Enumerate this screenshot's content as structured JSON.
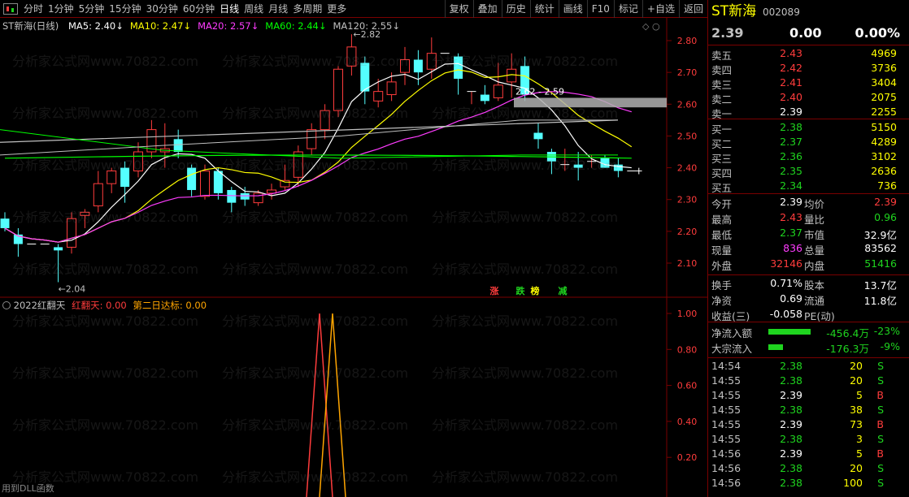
{
  "toolbar": {
    "periods": [
      "分时",
      "1分钟",
      "5分钟",
      "15分钟",
      "30分钟",
      "60分钟",
      "日线",
      "周线",
      "月线",
      "多周期",
      "更多"
    ],
    "active_period": "日线",
    "right_buttons": [
      "复权",
      "叠加",
      "历史",
      "统计",
      "画线",
      "F10",
      "标记",
      "+自选",
      "返回"
    ]
  },
  "main_chart": {
    "title": "ST新海(日线)",
    "ma": [
      {
        "label": "MA5: 2.40",
        "arrow": "↓",
        "color": "#ffffff"
      },
      {
        "label": "MA10: 2.47",
        "arrow": "↓",
        "color": "#ffff00"
      },
      {
        "label": "MA20: 2.57",
        "arrow": "↓",
        "color": "#ff3cff"
      },
      {
        "label": "MA60: 2.44",
        "arrow": "↓",
        "color": "#00ff00"
      },
      {
        "label": "MA120: 2.55",
        "arrow": "↓",
        "color": "#c0c0c0"
      }
    ],
    "high_marker": "2.82",
    "low_marker": "2.04",
    "range_label": "2.62 - 2.59",
    "y_ticks": [
      "2.80",
      "2.70",
      "2.60",
      "2.50",
      "2.40",
      "2.30",
      "2.20",
      "2.10"
    ],
    "signals": [
      {
        "text": "涨",
        "color": "#ff3c3c"
      },
      {
        "text": "跌",
        "color": "#1fd41f"
      },
      {
        "text": "榜",
        "color": "#ffff00"
      },
      {
        "text": "减",
        "color": "#1fd41f"
      }
    ]
  },
  "indicator": {
    "title": "2022红翻天",
    "series1": "红翻天: 0.00",
    "series2": "第二日达标: 0.00",
    "y_ticks": [
      "1.00",
      "0.80",
      "0.60",
      "0.40",
      "0.20"
    ],
    "footer": "用到DLL函数"
  },
  "watermark": "分析家公式网www.70822.com",
  "stock": {
    "name": "ST新海",
    "code": "002089",
    "price": "2.39",
    "change": "0.00",
    "pct": "0.00%"
  },
  "sells": [
    {
      "label": "卖五",
      "price": "2.43",
      "vol": "4969",
      "pc": "red"
    },
    {
      "label": "卖四",
      "price": "2.42",
      "vol": "3736",
      "pc": "red"
    },
    {
      "label": "卖三",
      "price": "2.41",
      "vol": "3404",
      "pc": "red"
    },
    {
      "label": "卖二",
      "price": "2.40",
      "vol": "2075",
      "pc": "red"
    },
    {
      "label": "卖一",
      "price": "2.39",
      "vol": "2255",
      "pc": "white"
    }
  ],
  "buys": [
    {
      "label": "买一",
      "price": "2.38",
      "vol": "5150",
      "pc": "green"
    },
    {
      "label": "买二",
      "price": "2.37",
      "vol": "4289",
      "pc": "green"
    },
    {
      "label": "买三",
      "price": "2.36",
      "vol": "3102",
      "pc": "green"
    },
    {
      "label": "买四",
      "price": "2.35",
      "vol": "2636",
      "pc": "green"
    },
    {
      "label": "买五",
      "price": "2.34",
      "vol": "736",
      "pc": "green"
    }
  ],
  "stats": [
    {
      "l1": "今开",
      "v1": "2.39",
      "c1": "white",
      "l2": "均价",
      "v2": "2.39",
      "c2": "red"
    },
    {
      "l1": "最高",
      "v1": "2.43",
      "c1": "red",
      "l2": "量比",
      "v2": "0.96",
      "c2": "green"
    },
    {
      "l1": "最低",
      "v1": "2.37",
      "c1": "green",
      "l2": "市值",
      "v2": "32.9亿",
      "c2": "white"
    },
    {
      "l1": "现量",
      "v1": "836",
      "c1": "mag",
      "l2": "总量",
      "v2": "83562",
      "c2": "white"
    },
    {
      "l1": "外盘",
      "v1": "32146",
      "c1": "red",
      "l2": "内盘",
      "v2": "51416",
      "c2": "green"
    }
  ],
  "stats2": [
    {
      "l1": "换手",
      "v1": "0.71%",
      "l2": "股本",
      "v2": "13.7亿"
    },
    {
      "l1": "净资",
      "v1": "0.69",
      "l2": "流通",
      "v2": "11.8亿"
    },
    {
      "l1": "收益(三)",
      "v1": "-0.058",
      "l2": "PE(动)",
      "v2": ""
    }
  ],
  "flows": [
    {
      "label": "净流入额",
      "value": "-456.4万",
      "pct": "-23%"
    },
    {
      "label": "大宗流入",
      "value": "-176.3万",
      "pct": "-9%"
    }
  ],
  "ticks": [
    {
      "time": "14:54",
      "price": "2.38",
      "pc": "green",
      "vol": "20",
      "bs": "S"
    },
    {
      "time": "14:55",
      "price": "2.38",
      "pc": "green",
      "vol": "20",
      "bs": "S"
    },
    {
      "time": "14:55",
      "price": "2.39",
      "pc": "white",
      "vol": "5",
      "bs": "B"
    },
    {
      "time": "14:55",
      "price": "2.38",
      "pc": "green",
      "vol": "38",
      "bs": "S"
    },
    {
      "time": "14:55",
      "price": "2.39",
      "pc": "white",
      "vol": "73",
      "bs": "B"
    },
    {
      "time": "14:55",
      "price": "2.38",
      "pc": "green",
      "vol": "3",
      "bs": "S"
    },
    {
      "time": "14:56",
      "price": "2.39",
      "pc": "white",
      "vol": "5",
      "bs": "B"
    },
    {
      "time": "14:56",
      "price": "2.38",
      "pc": "green",
      "vol": "20",
      "bs": "S"
    },
    {
      "time": "14:56",
      "price": "2.38",
      "pc": "green",
      "vol": "100",
      "bs": "S"
    }
  ]
}
